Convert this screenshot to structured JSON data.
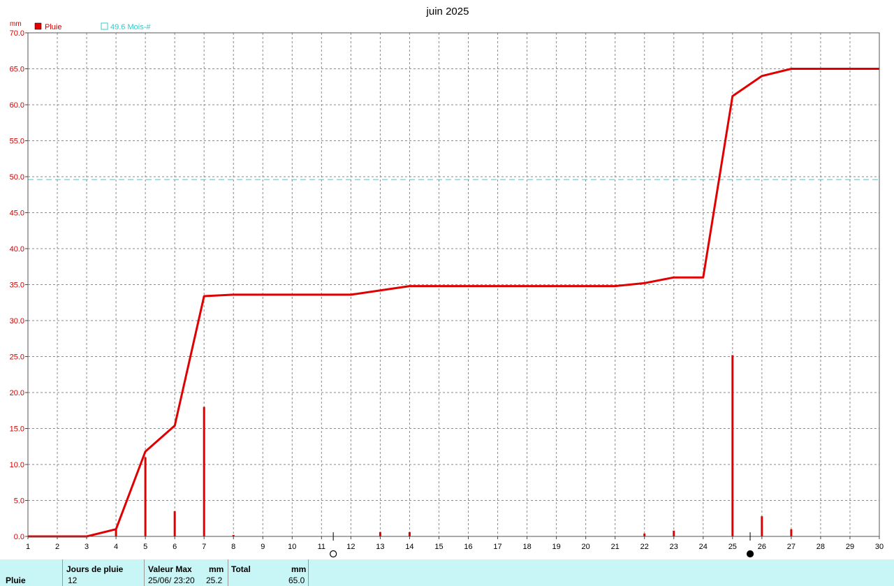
{
  "chart_data": {
    "type": "line",
    "title": "juin 2025",
    "y_unit": "mm",
    "ylim": [
      0,
      70
    ],
    "y_ticks": [
      "0.0",
      "5.0",
      "10.0",
      "15.0",
      "20.0",
      "25.0",
      "30.0",
      "35.0",
      "40.0",
      "45.0",
      "50.0",
      "55.0",
      "60.0",
      "65.0",
      "70.0"
    ],
    "xlim": [
      1,
      30
    ],
    "x_ticks": [
      "1",
      "2",
      "3",
      "4",
      "5",
      "6",
      "7",
      "8",
      "9",
      "10",
      "11",
      "12",
      "13",
      "14",
      "15",
      "16",
      "17",
      "18",
      "19",
      "20",
      "21",
      "22",
      "23",
      "24",
      "25",
      "26",
      "27",
      "28",
      "29",
      "30"
    ],
    "grid": true,
    "legend": [
      {
        "label": "Pluie",
        "color": "#e00000"
      },
      {
        "label": "49.6 Mois-#",
        "color": "#30d0d0"
      }
    ],
    "reference_line": {
      "name": "49.6 Mois-#",
      "value": 49.6,
      "color": "#30d0d0"
    },
    "series": [
      {
        "name": "Pluie",
        "kind": "cumulative",
        "color": "#e00000",
        "x": [
          1,
          3,
          4,
          5,
          6,
          7,
          8,
          12,
          14,
          21,
          22,
          23,
          24,
          25,
          26,
          27,
          30
        ],
        "values": [
          0.0,
          0.0,
          1.0,
          11.8,
          15.4,
          33.4,
          33.6,
          33.6,
          34.8,
          34.8,
          35.2,
          36.0,
          36.0,
          61.2,
          64.0,
          65.0,
          65.0
        ]
      },
      {
        "name": "Pluie",
        "kind": "daily",
        "color": "#e00000",
        "x": [
          4,
          5,
          6,
          7,
          8,
          13,
          14,
          22,
          23,
          25,
          26,
          27
        ],
        "values": [
          1.0,
          11.0,
          3.5,
          18.0,
          0.2,
          0.6,
          0.6,
          0.4,
          0.8,
          25.2,
          2.8,
          1.0
        ]
      }
    ],
    "moon_phases": [
      {
        "x": 11.4,
        "phase": "full"
      },
      {
        "x": 25.6,
        "phase": "new"
      }
    ]
  },
  "summary": {
    "row_label": "Pluie",
    "jours_header": "Jours de pluie",
    "jours_value": "12",
    "max_header": "Valeur Max",
    "max_unit": "mm",
    "max_date": "25/06/  23:20",
    "max_value": "25.2",
    "total_header": "Total",
    "total_unit": "mm",
    "total_value": "65.0"
  }
}
